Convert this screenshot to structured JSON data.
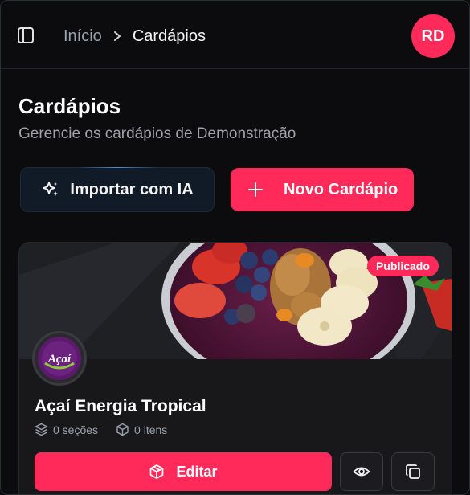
{
  "header": {
    "breadcrumb": {
      "home": "Início",
      "current": "Cardápios"
    },
    "avatar_initials": "RD",
    "icons": [
      "sidebar-toggle-icon",
      "chevron-right-icon"
    ]
  },
  "page": {
    "title": "Cardápios",
    "subtitle": "Gerencie os cardápios de Demonstração"
  },
  "actions": {
    "import_label": "Importar com IA",
    "new_label": "Novo Cardápio"
  },
  "menu_card": {
    "status": "Publicado",
    "logo_text": "Açaí",
    "name": "Açaí Energia Tropical",
    "sections": "0 seções",
    "items": "0 itens",
    "edit_label": "Editar"
  },
  "colors": {
    "accent": "#ff2a5a",
    "background": "#0c0c0e",
    "card": "#18181b",
    "import_button": "#111a27",
    "muted_text": "#a1a1aa"
  }
}
